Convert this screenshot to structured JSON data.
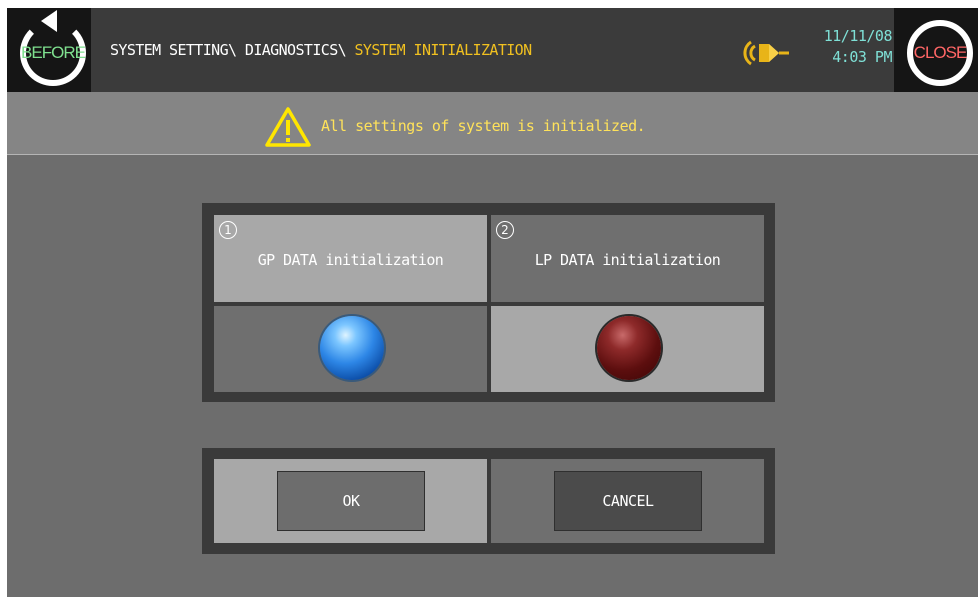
{
  "header": {
    "before_label": "BEFORE",
    "close_label": "CLOSE",
    "breadcrumb_path": "SYSTEM SETTING\\ DIAGNOSTICS\\ ",
    "breadcrumb_current": "SYSTEM INITIALIZATION",
    "date": "11/11/08",
    "time": "4:03 PM",
    "sound_icon": "speaker-icon"
  },
  "status": {
    "message": "All settings of system is initialized.",
    "icon": "warning-icon"
  },
  "options": [
    {
      "number": "1",
      "label": "GP DATA initialization",
      "indicator": "blue-lamp",
      "color": "#2d86e6"
    },
    {
      "number": "2",
      "label": "LP DATA initialization",
      "indicator": "red-lamp",
      "color": "#5c0e0e"
    }
  ],
  "actions": {
    "ok_label": "OK",
    "cancel_label": "CANCEL"
  },
  "colors": {
    "header_bg": "#3b3b3b",
    "accent_yellow": "#f0c020",
    "time_color": "#7fe0d6",
    "screen_bg": "#6d6d6d"
  }
}
